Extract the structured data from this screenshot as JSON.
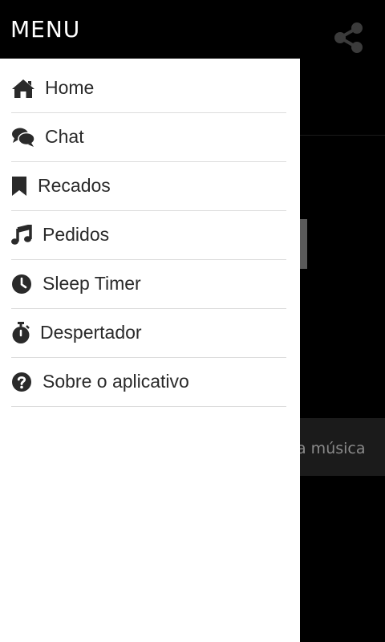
{
  "header": {
    "title": "MENU",
    "share_icon": "share-icon"
  },
  "background": {
    "now_playing_fragment": "a música"
  },
  "drawer": {
    "items": [
      {
        "label": "Home",
        "icon": "home-icon"
      },
      {
        "label": "Chat",
        "icon": "chat-icon"
      },
      {
        "label": "Recados",
        "icon": "bookmark-icon"
      },
      {
        "label": "Pedidos",
        "icon": "music-note-icon"
      },
      {
        "label": "Sleep Timer",
        "icon": "clock-icon"
      },
      {
        "label": "Despertador",
        "icon": "stopwatch-icon"
      },
      {
        "label": "Sobre o aplicativo",
        "icon": "help-icon"
      }
    ]
  },
  "colors": {
    "drawer_bg": "#ffffff",
    "app_bg": "#000000",
    "icon": "#2a2a2a"
  }
}
